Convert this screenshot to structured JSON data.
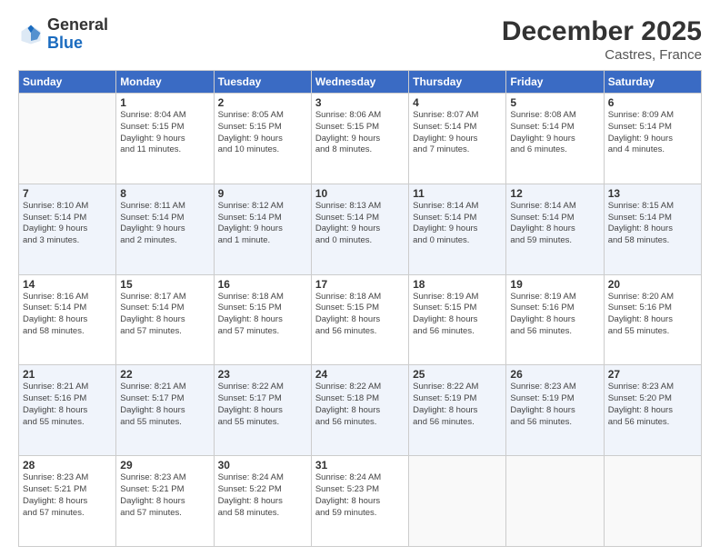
{
  "header": {
    "logo_line1": "General",
    "logo_line2": "Blue",
    "month_title": "December 2025",
    "location": "Castres, France"
  },
  "columns": [
    "Sunday",
    "Monday",
    "Tuesday",
    "Wednesday",
    "Thursday",
    "Friday",
    "Saturday"
  ],
  "weeks": [
    [
      {
        "day": "",
        "info": ""
      },
      {
        "day": "1",
        "info": "Sunrise: 8:04 AM\nSunset: 5:15 PM\nDaylight: 9 hours\nand 11 minutes."
      },
      {
        "day": "2",
        "info": "Sunrise: 8:05 AM\nSunset: 5:15 PM\nDaylight: 9 hours\nand 10 minutes."
      },
      {
        "day": "3",
        "info": "Sunrise: 8:06 AM\nSunset: 5:15 PM\nDaylight: 9 hours\nand 8 minutes."
      },
      {
        "day": "4",
        "info": "Sunrise: 8:07 AM\nSunset: 5:14 PM\nDaylight: 9 hours\nand 7 minutes."
      },
      {
        "day": "5",
        "info": "Sunrise: 8:08 AM\nSunset: 5:14 PM\nDaylight: 9 hours\nand 6 minutes."
      },
      {
        "day": "6",
        "info": "Sunrise: 8:09 AM\nSunset: 5:14 PM\nDaylight: 9 hours\nand 4 minutes."
      }
    ],
    [
      {
        "day": "7",
        "info": "Sunrise: 8:10 AM\nSunset: 5:14 PM\nDaylight: 9 hours\nand 3 minutes."
      },
      {
        "day": "8",
        "info": "Sunrise: 8:11 AM\nSunset: 5:14 PM\nDaylight: 9 hours\nand 2 minutes."
      },
      {
        "day": "9",
        "info": "Sunrise: 8:12 AM\nSunset: 5:14 PM\nDaylight: 9 hours\nand 1 minute."
      },
      {
        "day": "10",
        "info": "Sunrise: 8:13 AM\nSunset: 5:14 PM\nDaylight: 9 hours\nand 0 minutes."
      },
      {
        "day": "11",
        "info": "Sunrise: 8:14 AM\nSunset: 5:14 PM\nDaylight: 9 hours\nand 0 minutes."
      },
      {
        "day": "12",
        "info": "Sunrise: 8:14 AM\nSunset: 5:14 PM\nDaylight: 8 hours\nand 59 minutes."
      },
      {
        "day": "13",
        "info": "Sunrise: 8:15 AM\nSunset: 5:14 PM\nDaylight: 8 hours\nand 58 minutes."
      }
    ],
    [
      {
        "day": "14",
        "info": "Sunrise: 8:16 AM\nSunset: 5:14 PM\nDaylight: 8 hours\nand 58 minutes."
      },
      {
        "day": "15",
        "info": "Sunrise: 8:17 AM\nSunset: 5:14 PM\nDaylight: 8 hours\nand 57 minutes."
      },
      {
        "day": "16",
        "info": "Sunrise: 8:18 AM\nSunset: 5:15 PM\nDaylight: 8 hours\nand 57 minutes."
      },
      {
        "day": "17",
        "info": "Sunrise: 8:18 AM\nSunset: 5:15 PM\nDaylight: 8 hours\nand 56 minutes."
      },
      {
        "day": "18",
        "info": "Sunrise: 8:19 AM\nSunset: 5:15 PM\nDaylight: 8 hours\nand 56 minutes."
      },
      {
        "day": "19",
        "info": "Sunrise: 8:19 AM\nSunset: 5:16 PM\nDaylight: 8 hours\nand 56 minutes."
      },
      {
        "day": "20",
        "info": "Sunrise: 8:20 AM\nSunset: 5:16 PM\nDaylight: 8 hours\nand 55 minutes."
      }
    ],
    [
      {
        "day": "21",
        "info": "Sunrise: 8:21 AM\nSunset: 5:16 PM\nDaylight: 8 hours\nand 55 minutes."
      },
      {
        "day": "22",
        "info": "Sunrise: 8:21 AM\nSunset: 5:17 PM\nDaylight: 8 hours\nand 55 minutes."
      },
      {
        "day": "23",
        "info": "Sunrise: 8:22 AM\nSunset: 5:17 PM\nDaylight: 8 hours\nand 55 minutes."
      },
      {
        "day": "24",
        "info": "Sunrise: 8:22 AM\nSunset: 5:18 PM\nDaylight: 8 hours\nand 56 minutes."
      },
      {
        "day": "25",
        "info": "Sunrise: 8:22 AM\nSunset: 5:19 PM\nDaylight: 8 hours\nand 56 minutes."
      },
      {
        "day": "26",
        "info": "Sunrise: 8:23 AM\nSunset: 5:19 PM\nDaylight: 8 hours\nand 56 minutes."
      },
      {
        "day": "27",
        "info": "Sunrise: 8:23 AM\nSunset: 5:20 PM\nDaylight: 8 hours\nand 56 minutes."
      }
    ],
    [
      {
        "day": "28",
        "info": "Sunrise: 8:23 AM\nSunset: 5:21 PM\nDaylight: 8 hours\nand 57 minutes."
      },
      {
        "day": "29",
        "info": "Sunrise: 8:23 AM\nSunset: 5:21 PM\nDaylight: 8 hours\nand 57 minutes."
      },
      {
        "day": "30",
        "info": "Sunrise: 8:24 AM\nSunset: 5:22 PM\nDaylight: 8 hours\nand 58 minutes."
      },
      {
        "day": "31",
        "info": "Sunrise: 8:24 AM\nSunset: 5:23 PM\nDaylight: 8 hours\nand 59 minutes."
      },
      {
        "day": "",
        "info": ""
      },
      {
        "day": "",
        "info": ""
      },
      {
        "day": "",
        "info": ""
      }
    ]
  ]
}
